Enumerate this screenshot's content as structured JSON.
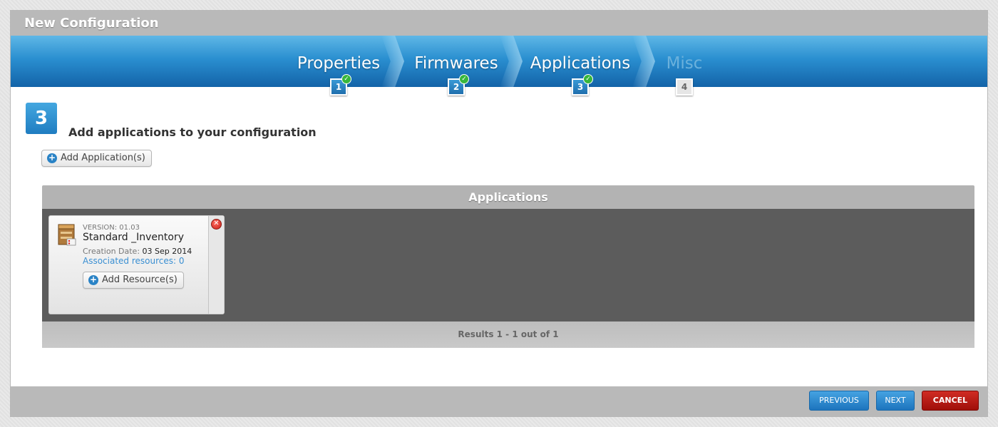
{
  "dialog": {
    "title": "New Configuration"
  },
  "wizard": {
    "steps": [
      {
        "label": "Properties",
        "number": "1",
        "completed": true
      },
      {
        "label": "Firmwares",
        "number": "2",
        "completed": true
      },
      {
        "label": "Applications",
        "number": "3",
        "completed": true
      },
      {
        "label": "Misc",
        "number": "4",
        "completed": false
      }
    ]
  },
  "main": {
    "step_number": "3",
    "heading": "Add applications to your configuration",
    "add_app_label": "Add Application(s)"
  },
  "applications": {
    "title": "Applications",
    "results": "Results 1 - 1 out of 1",
    "items": [
      {
        "version": "VERSION: 01.03",
        "name": "Standard _Inventory",
        "creation_label": "Creation Date:",
        "creation_date": "03 Sep 2014",
        "associated": "Associated resources: 0",
        "add_resource_label": "Add Resource(s)"
      }
    ]
  },
  "footer": {
    "previous_label": "PREVIOUS",
    "next_label": "NEXT",
    "cancel_label": "CANCEL"
  },
  "colors": {
    "accent": "#2a8fd0",
    "cancel": "#b3160f",
    "check": "#37b63c"
  }
}
